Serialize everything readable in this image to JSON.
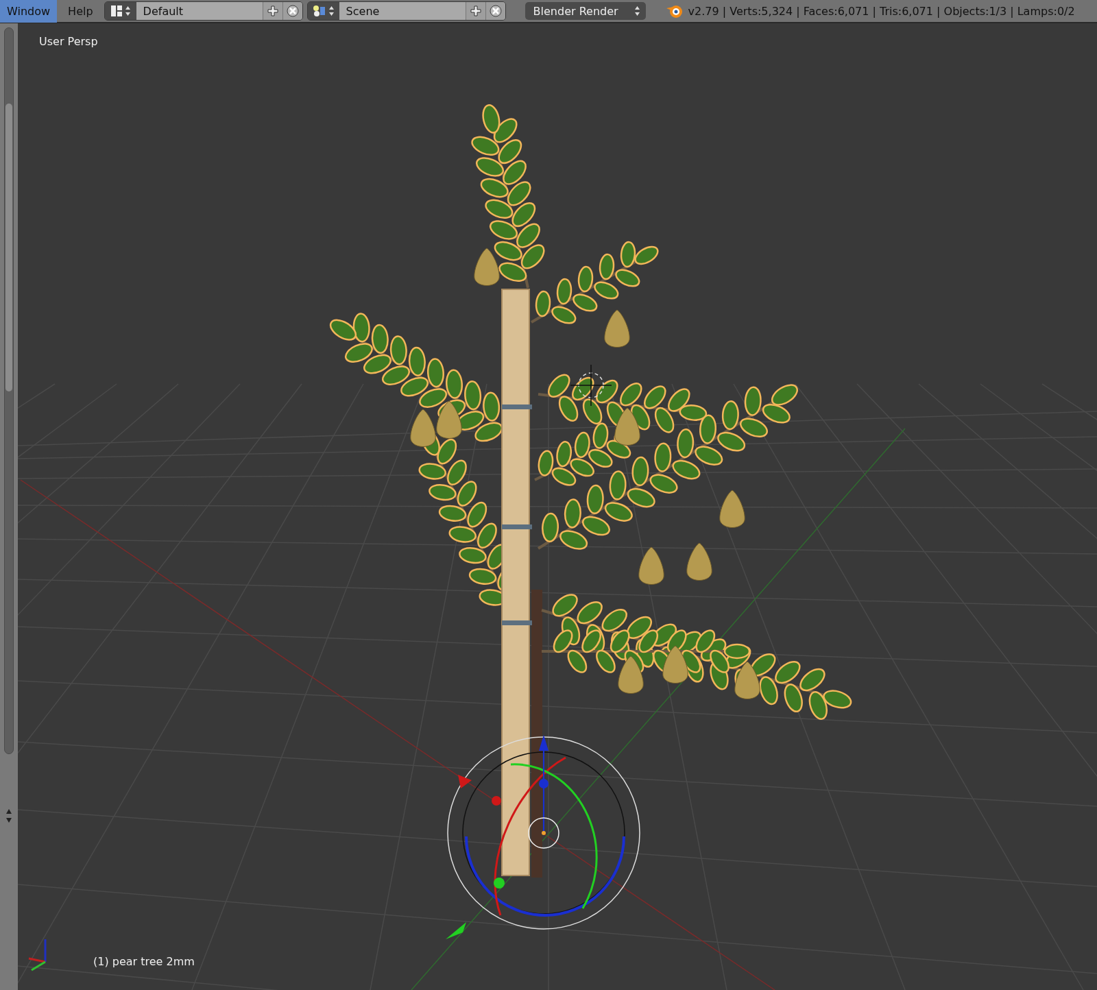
{
  "menu": [
    {
      "label": "Window",
      "selected": true
    },
    {
      "label": "Help",
      "selected": false
    }
  ],
  "screen_layout": {
    "value": "Default"
  },
  "scene": {
    "value": "Scene"
  },
  "render_engine": {
    "value": "Blender Render"
  },
  "stats": "v2.79 | Verts:5,324 | Faces:6,071 | Tris:6,071 | Objects:1/3 | Lamps:0/2",
  "viewport": {
    "view_name": "User Persp",
    "object_label": "(1) pear tree 2mm"
  }
}
